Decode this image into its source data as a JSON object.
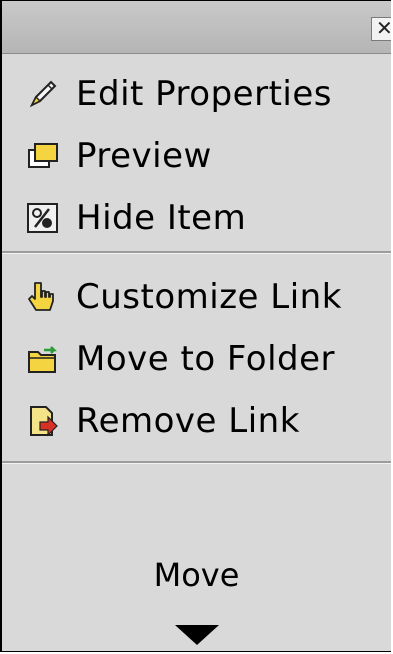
{
  "close_glyph": "✕",
  "menu": {
    "group1": [
      {
        "label": "Edit Properties",
        "icon": "pencil-icon"
      },
      {
        "label": "Preview",
        "icon": "preview-window-icon"
      },
      {
        "label": "Hide Item",
        "icon": "hide-item-icon"
      }
    ],
    "group2": [
      {
        "label": "Customize Link",
        "icon": "hand-pointer-icon"
      },
      {
        "label": "Move to Folder",
        "icon": "folder-move-icon"
      },
      {
        "label": "Remove Link",
        "icon": "remove-link-icon"
      }
    ]
  },
  "move": {
    "label": "Move",
    "arrow_icon": "down-arrow-icon"
  },
  "colors": {
    "panel_bg": "#d9d9d9",
    "titlebar_bg": "#c0c0c0",
    "icon_yellow": "#f5d442",
    "icon_red": "#d93025"
  }
}
